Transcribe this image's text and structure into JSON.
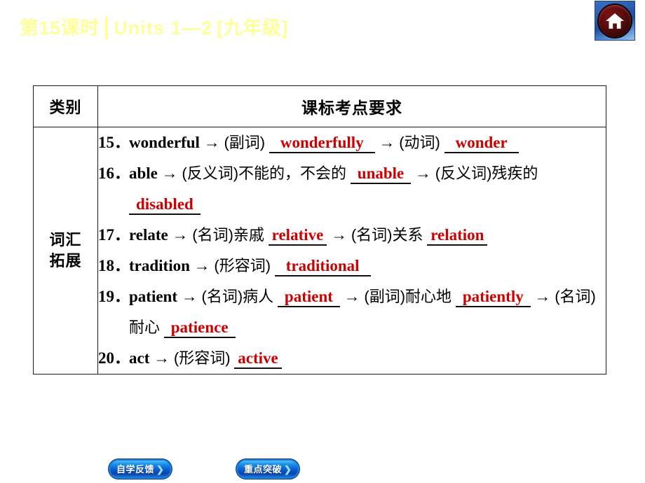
{
  "header": {
    "lesson": "第15课时",
    "separator": "┃",
    "units": "Units 1—2",
    "grade": "[九年级]",
    "home_icon": "home-icon"
  },
  "table": {
    "headers": {
      "category": "类别",
      "requirement": "课标考点要求"
    },
    "category_label_line1": "词汇",
    "category_label_line2": "拓展",
    "items": [
      {
        "num": "15．",
        "parts": [
          {
            "type": "en",
            "text": "wonderful"
          },
          {
            "type": "arrow",
            "text": "→"
          },
          {
            "type": "cn",
            "text": "(副词)"
          },
          {
            "type": "answer",
            "text": "wonderfully"
          },
          {
            "type": "arrow",
            "text": "→"
          },
          {
            "type": "cn",
            "text": "(动词)"
          },
          {
            "type": "answer",
            "text": "wonder"
          }
        ]
      },
      {
        "num": "16．",
        "parts": [
          {
            "type": "en",
            "text": "able"
          },
          {
            "type": "arrow",
            "text": "→"
          },
          {
            "type": "cn",
            "text": "(反义词)不能的，不会的"
          },
          {
            "type": "answer",
            "text": "unable"
          },
          {
            "type": "arrow",
            "text": "→"
          },
          {
            "type": "cn",
            "text": "(反义词)残疾的"
          },
          {
            "type": "answer",
            "text": "disabled"
          }
        ]
      },
      {
        "num": "17．",
        "parts": [
          {
            "type": "en",
            "text": "relate"
          },
          {
            "type": "arrow",
            "text": "→"
          },
          {
            "type": "cn",
            "text": "(名词)亲戚"
          },
          {
            "type": "answer",
            "text": "relative"
          },
          {
            "type": "arrow",
            "text": "→"
          },
          {
            "type": "cn",
            "text": "(名词)关系"
          },
          {
            "type": "answer",
            "text": "relation"
          }
        ]
      },
      {
        "num": "18．",
        "parts": [
          {
            "type": "en",
            "text": "tradition"
          },
          {
            "type": "arrow",
            "text": "→"
          },
          {
            "type": "cn",
            "text": "(形容词)"
          },
          {
            "type": "answer",
            "text": "traditional"
          }
        ]
      },
      {
        "num": "19．",
        "parts": [
          {
            "type": "en",
            "text": "patient"
          },
          {
            "type": "arrow",
            "text": "→"
          },
          {
            "type": "cn",
            "text": "(名词)病人"
          },
          {
            "type": "answer",
            "text": "patient"
          },
          {
            "type": "arrow",
            "text": "→"
          },
          {
            "type": "cn",
            "text": "(副词)耐心地"
          },
          {
            "type": "answer",
            "text": "patiently"
          },
          {
            "type": "arrow",
            "text": "→"
          },
          {
            "type": "cn",
            "text": "(名词)耐心"
          },
          {
            "type": "answer",
            "text": "patience"
          }
        ]
      },
      {
        "num": "20．",
        "parts": [
          {
            "type": "en",
            "text": "act"
          },
          {
            "type": "arrow",
            "text": "→"
          },
          {
            "type": "cn",
            "text": "(形容词)"
          },
          {
            "type": "answer",
            "text": "active"
          }
        ]
      }
    ]
  },
  "footer": {
    "buttons": [
      {
        "label": "自学反馈",
        "chevron": "❯"
      },
      {
        "label": "重点突破",
        "chevron": "❯"
      }
    ]
  },
  "colors": {
    "title_yellow": "#ffff99",
    "answer_red": "#cc0000",
    "button_blue": "#0b5fd0",
    "home_red": "#5e0d0d"
  }
}
